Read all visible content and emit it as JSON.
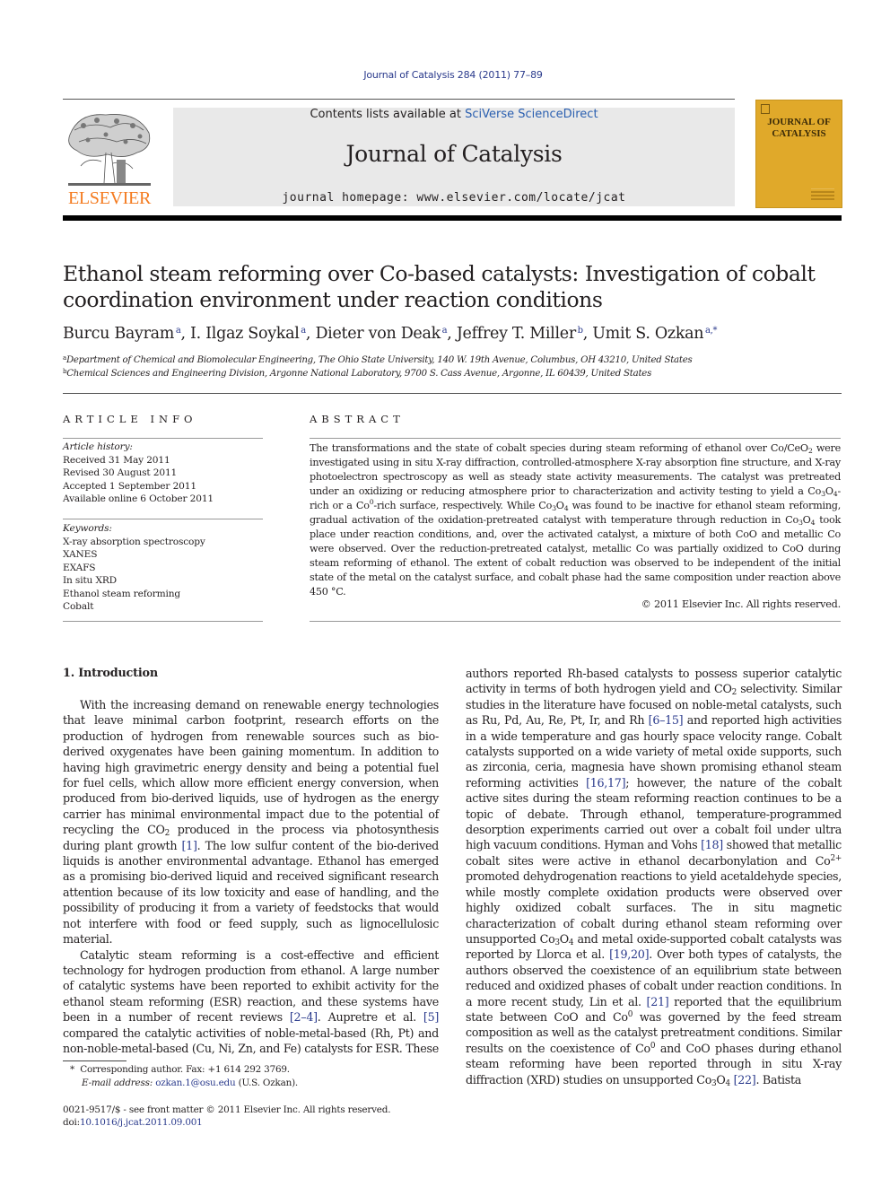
{
  "header": {
    "citation": "Journal of Catalysis 284 (2011) 77–89",
    "contents_prefix": "Contents lists available at ",
    "contents_link": "SciVerse ScienceDirect",
    "journal_name": "Journal of Catalysis",
    "homepage": "journal homepage: www.elsevier.com/locate/jcat",
    "publisher_logo_text": "ELSEVIER",
    "cover_title_line1": "JOURNAL OF",
    "cover_title_line2": "CATALYSIS"
  },
  "article": {
    "title_line1": "Ethanol steam reforming over Co-based catalysts: Investigation of cobalt",
    "title_line2": "coordination environment under reaction conditions",
    "authors": [
      {
        "name": "Burcu Bayram",
        "sup": "a"
      },
      {
        "name": "I. Ilgaz Soykal",
        "sup": "a"
      },
      {
        "name": "Dieter von Deak",
        "sup": "a"
      },
      {
        "name": "Jeffrey T. Miller",
        "sup": "b"
      },
      {
        "name": "Umit S. Ozkan",
        "sup": "a,*"
      }
    ],
    "affiliations": [
      {
        "sup": "a",
        "text": "Department of Chemical and Biomolecular Engineering, The Ohio State University, 140 W. 19th Avenue, Columbus, OH 43210, United States"
      },
      {
        "sup": "b",
        "text": "Chemical Sciences and Engineering Division, Argonne National Laboratory, 9700 S. Cass Avenue, Argonne, IL 60439, United States"
      }
    ]
  },
  "article_info": {
    "heading": "ARTICLE INFO",
    "history_label": "Article history:",
    "history": [
      "Received 31 May 2011",
      "Revised 30 August 2011",
      "Accepted 1 September 2011",
      "Available online 6 October 2011"
    ],
    "keywords_label": "Keywords:",
    "keywords": [
      "X-ray absorption spectroscopy",
      "XANES",
      "EXAFS",
      "In situ XRD",
      "Ethanol steam reforming",
      "Cobalt"
    ]
  },
  "abstract": {
    "heading": "ABSTRACT",
    "parts": {
      "p1": "The transformations and the state of cobalt species during steam reforming of ethanol over Co/CeO",
      "p2": " were investigated using in situ X-ray diffraction, controlled-atmosphere X-ray absorption fine structure, and X-ray photoelectron spectroscopy as well as steady state activity measurements. The catalyst was pretreated under an oxidizing or reducing atmosphere prior to characterization and activity testing to yield a Co",
      "p3": "-rich or a Co",
      "p4": "-rich surface, respectively. While Co",
      "p5": " was found to be inactive for ethanol steam reforming, gradual activation of the oxidation-pretreated catalyst with temperature through reduction in Co",
      "p6": " took place under reaction conditions, and, over the activated catalyst, a mixture of both CoO and metallic Co were observed. Over the reduction-pretreated catalyst, metallic Co was partially oxidized to CoO during steam reforming of ethanol. The extent of cobalt reduction was observed to be independent of the initial state of the metal on the catalyst surface, and cobalt phase had the same composition under reaction above 450 °C."
    },
    "copyright": "© 2011 Elsevier Inc. All rights reserved."
  },
  "intro": {
    "heading": "1. Introduction",
    "left_p1a": "With the increasing demand on renewable energy technologies that leave minimal carbon footprint, research efforts on the production of hydrogen from renewable sources such as bio-derived oxygenates have been gaining momentum. In addition to having high gravimetric energy density and being a potential fuel for fuel cells, which allow more efficient energy conversion, when produced from bio-derived liquids, use of hydrogen as the energy carrier has minimal environmental impact due to the potential of recycling the CO",
    "left_p1b": " produced in the process via photosynthesis during plant growth ",
    "ref1": "[1]",
    "left_p1c": ". The low sulfur content of the bio-derived liquids is another environmental advantage. Ethanol has emerged as a promising bio-derived liquid and received significant research attention because of its low toxicity and ease of handling, and the possibility of producing it from a variety of feedstocks that would not interfere with food or feed supply, such as lignocellulosic material.",
    "left_p2a": "Catalytic steam reforming is a cost-effective and efficient technology for hydrogen production from ethanol. A large number of catalytic systems have been reported to exhibit activity for the ethanol steam reforming (ESR) reaction, and these systems have been in a number of recent reviews ",
    "ref2_4": "[2–4]",
    "left_p2b": ". Aupretre et al. ",
    "ref5": "[5]",
    "left_p2c": " compared the catalytic activities of noble-metal-based (Rh, Pt) and non-noble-metal-based (Cu, Ni, Zn, and Fe) catalysts for ESR. These",
    "right_a": "authors reported Rh-based catalysts to possess superior catalytic activity in terms of both hydrogen yield and CO",
    "right_b": " selectivity. Similar studies in the literature have focused on noble-metal catalysts, such as Ru, Pd, Au, Re, Pt, Ir, and Rh ",
    "ref6_15": "[6–15]",
    "right_c": " and reported high activities in a wide temperature and gas hourly space velocity range. Cobalt catalysts supported on a wide variety of metal oxide supports, such as zirconia, ceria, magnesia have shown promising ethanol steam reforming activities ",
    "ref16_17": "[16,17]",
    "right_d": "; however, the nature of the cobalt active sites during the steam reforming reaction continues to be a topic of debate. Through ethanol, temperature-programmed desorption experiments carried out over a cobalt foil under ultra high vacuum conditions. Hyman and Vohs ",
    "ref18": "[18]",
    "right_e": " showed that metallic cobalt sites were active in ethanol decarbonylation and Co",
    "right_f": " promoted dehydrogenation reactions to yield acetaldehyde species, while mostly complete oxidation products were observed over highly oxidized cobalt surfaces. The in situ magnetic characterization of cobalt during ethanol steam reforming over unsupported Co",
    "right_g": " and metal oxide-supported cobalt catalysts was reported by Llorca et al. ",
    "ref19_20": "[19,20]",
    "right_h": ". Over both types of catalysts, the authors observed the coexistence of an equilibrium state between reduced and oxidized phases of cobalt under reaction conditions. In a more recent study, Lin et al. ",
    "ref21": "[21]",
    "right_i": " reported that the equilibrium state between CoO and Co",
    "right_j": " was governed by the feed stream composition as well as the catalyst pretreatment conditions. Similar results on the coexistence of Co",
    "right_k": " and CoO phases during ethanol steam reforming have been reported through in situ X-ray diffraction (XRD) studies on unsupported Co",
    "ref22": "[22]",
    "right_l": ". Batista"
  },
  "chem": {
    "sub2": "2",
    "sub3": "3",
    "sub4": "4",
    "sup0": "0",
    "sup2plus": "2+",
    "Co": "Co",
    "O": "O"
  },
  "footnotes": {
    "star": "*",
    "corresponding": "Corresponding author. Fax: +1 614 292 3769.",
    "email_label": "E-mail address:",
    "email": "ozkan.1@osu.edu",
    "email_owner": " (U.S. Ozkan).",
    "front_matter": "0021-9517/$ - see front matter © 2011 Elsevier Inc. All rights reserved.",
    "doi_label": "doi:",
    "doi": "10.1016/j.jcat.2011.09.001"
  }
}
